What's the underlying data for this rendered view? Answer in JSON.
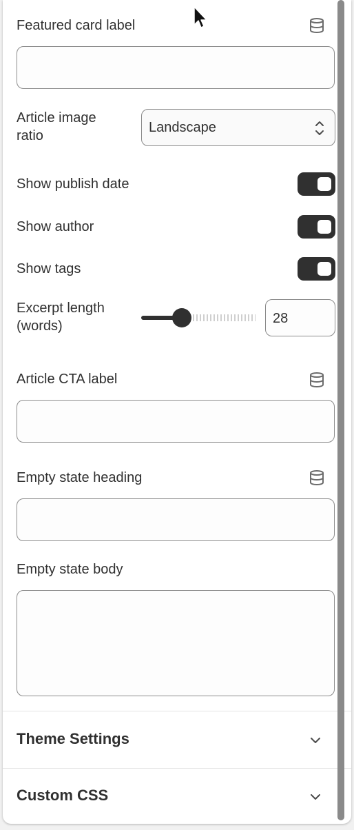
{
  "fields": {
    "featured_card_label": {
      "label": "Featured card label",
      "value": ""
    },
    "article_image_ratio": {
      "label_line1": "Article image",
      "label_line2": "ratio",
      "value": "Landscape"
    },
    "show_publish_date": {
      "label": "Show publish date",
      "checked": true
    },
    "show_author": {
      "label": "Show author",
      "checked": true
    },
    "show_tags": {
      "label": "Show tags",
      "checked": true
    },
    "excerpt_length": {
      "label_line1": "Excerpt length",
      "label_line2": "(words)",
      "value": "28",
      "slider_fraction": 0.36
    },
    "article_cta_label": {
      "label": "Article CTA label",
      "value": ""
    },
    "empty_state_heading": {
      "label": "Empty state heading",
      "value": ""
    },
    "empty_state_body": {
      "label": "Empty state body",
      "value": ""
    }
  },
  "sections": {
    "theme_settings": {
      "title": "Theme Settings"
    },
    "custom_css": {
      "title": "Custom CSS"
    }
  },
  "icons": {
    "dynamic_source": "database-icon",
    "select_chevron": "chevron-up-down-icon",
    "section_chevron": "chevron-down-icon",
    "cursor": "mouse-pointer-icon"
  },
  "colors": {
    "toggle_on": "#303030",
    "border": "#8a8a8a",
    "text": "#303030"
  }
}
